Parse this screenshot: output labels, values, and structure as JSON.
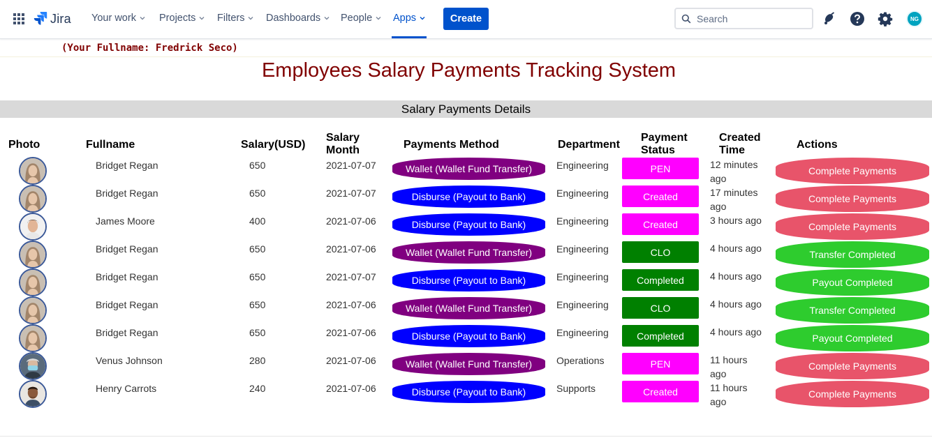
{
  "nav": {
    "brand": "Jira",
    "items": [
      {
        "label": "Your work",
        "active": false
      },
      {
        "label": "Projects",
        "active": false
      },
      {
        "label": "Filters",
        "active": false
      },
      {
        "label": "Dashboards",
        "active": false
      },
      {
        "label": "People",
        "active": false
      },
      {
        "label": "Apps",
        "active": true
      }
    ],
    "create_label": "Create",
    "search_placeholder": "Search",
    "avatar_initials": "NG",
    "icons": [
      "app-switcher-icon",
      "jira-logo-icon",
      "notifications-icon",
      "help-icon",
      "settings-icon"
    ]
  },
  "page": {
    "fullname_line": "(Your Fullname: Fredrick Seco)",
    "title": "Employees Salary Payments Tracking System",
    "section_title": "Salary Payments Details"
  },
  "table": {
    "headers": {
      "photo": "Photo",
      "fullname": "Fullname",
      "salary": "Salary(USD)",
      "salary_month_1": "Salary",
      "salary_month_2": "Month",
      "method": "Payments Method",
      "department": "Department",
      "status_1": "Payment",
      "status_2": "Status",
      "created_1": "Created",
      "created_2": "Time",
      "actions": "Actions"
    },
    "rows": [
      {
        "photo": "female-avatar",
        "name": "Bridget Regan",
        "salary": "650",
        "month": "2021-07-07",
        "method": "Wallet (Wallet Fund Transfer)",
        "method_color": "#800080",
        "department": "Engineering",
        "status": "PEN",
        "status_color": "#ff00ff",
        "created": "12 minutes ago",
        "action": "Complete Payments",
        "action_color": "#e8546a"
      },
      {
        "photo": "female-avatar",
        "name": "Bridget Regan",
        "salary": "650",
        "month": "2021-07-07",
        "method": "Disburse (Payout to Bank)",
        "method_color": "#0000ff",
        "department": "Engineering",
        "status": "Created",
        "status_color": "#ff00ff",
        "created": "17 minutes ago",
        "action": "Complete Payments",
        "action_color": "#e8546a"
      },
      {
        "photo": "male-avatar",
        "name": "James Moore",
        "salary": "400",
        "month": "2021-07-06",
        "method": "Disburse (Payout to Bank)",
        "method_color": "#0000ff",
        "department": "Engineering",
        "status": "Created",
        "status_color": "#ff00ff",
        "created": "3 hours ago",
        "action": "Complete Payments",
        "action_color": "#e8546a"
      },
      {
        "photo": "female-avatar",
        "name": "Bridget Regan",
        "salary": "650",
        "month": "2021-07-06",
        "method": "Wallet (Wallet Fund Transfer)",
        "method_color": "#800080",
        "department": "Engineering",
        "status": "CLO",
        "status_color": "#008000",
        "created": "4 hours ago",
        "action": "Transfer Completed",
        "action_color": "#2ecc2e"
      },
      {
        "photo": "female-avatar",
        "name": "Bridget Regan",
        "salary": "650",
        "month": "2021-07-07",
        "method": "Disburse (Payout to Bank)",
        "method_color": "#0000ff",
        "department": "Engineering",
        "status": "Completed",
        "status_color": "#008000",
        "created": "4 hours ago",
        "action": "Payout Completed",
        "action_color": "#2ecc2e"
      },
      {
        "photo": "female-avatar",
        "name": "Bridget Regan",
        "salary": "650",
        "month": "2021-07-06",
        "method": "Wallet (Wallet Fund Transfer)",
        "method_color": "#800080",
        "department": "Engineering",
        "status": "CLO",
        "status_color": "#008000",
        "created": "4 hours ago",
        "action": "Transfer Completed",
        "action_color": "#2ecc2e"
      },
      {
        "photo": "female-avatar",
        "name": "Bridget Regan",
        "salary": "650",
        "month": "2021-07-06",
        "method": "Disburse (Payout to Bank)",
        "method_color": "#0000ff",
        "department": "Engineering",
        "status": "Completed",
        "status_color": "#008000",
        "created": "4 hours ago",
        "action": "Payout Completed",
        "action_color": "#2ecc2e"
      },
      {
        "photo": "masked-avatar",
        "name": "Venus Johnson",
        "salary": "280",
        "month": "2021-07-06",
        "method": "Wallet (Wallet Fund Transfer)",
        "method_color": "#800080",
        "department": "Operations",
        "status": "PEN",
        "status_color": "#ff00ff",
        "created": "11 hours ago",
        "action": "Complete Payments",
        "action_color": "#e8546a"
      },
      {
        "photo": "male-avatar-2",
        "name": "Henry Carrots",
        "salary": "240",
        "month": "2021-07-06",
        "method": "Disburse (Payout to Bank)",
        "method_color": "#0000ff",
        "department": "Supports",
        "status": "Created",
        "status_color": "#ff00ff",
        "created": "11 hours ago",
        "action": "Complete Payments",
        "action_color": "#e8546a"
      }
    ]
  }
}
